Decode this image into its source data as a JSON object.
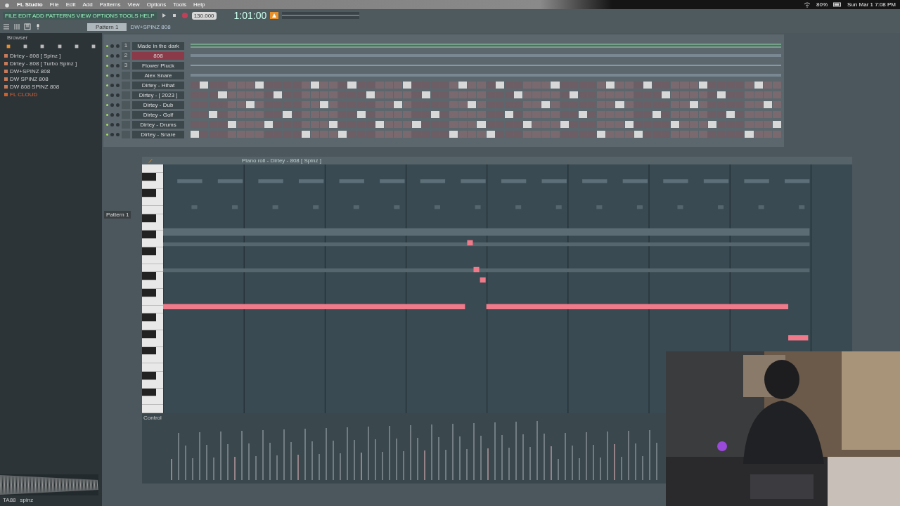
{
  "menu_bar": {
    "app": "FL Studio",
    "items": [
      "File",
      "Edit",
      "Add",
      "Patterns",
      "View",
      "Options",
      "Tools",
      "Help"
    ],
    "battery": "80%",
    "datetime": "Sun Mar 1  7:08 PM"
  },
  "toolbar": {
    "hint": "FILE EDIT ADD PATTERNS VIEW OPTIONS TOOLS HELP",
    "tempo": "130.000",
    "time": "1:01:00",
    "pattern": "Pattern 1",
    "plugin": "DW+SPINZ 808"
  },
  "browser": {
    "title": "Browser",
    "items": [
      {
        "label": "Dirtey - 808 [ Spinz ]",
        "kind": "file"
      },
      {
        "label": "Dirtey - 808 [ Turbo Spinz ]",
        "kind": "file"
      },
      {
        "label": "DW+SPINZ 808",
        "kind": "file"
      },
      {
        "label": "DW SPINZ 808",
        "kind": "file"
      },
      {
        "label": "DW 808 SPINZ 808",
        "kind": "file"
      },
      {
        "label": "FL CLOUD",
        "kind": "cloud"
      }
    ],
    "sample_tag": "TA88",
    "sample_name": "spinz"
  },
  "channel_rack": {
    "channels": [
      {
        "number": "1",
        "name": "Made in the dark",
        "selected": false
      },
      {
        "number": "2",
        "name": "808",
        "selected": true
      },
      {
        "number": "3",
        "name": "Flower Pluck",
        "selected": false
      },
      {
        "name": "Alex Snare",
        "selected": false
      },
      {
        "name": "Dirtey - Hihat",
        "selected": false
      },
      {
        "name": "Dirtey - [ 2023 ]",
        "selected": false
      },
      {
        "name": "Dirtey - Dub",
        "selected": false
      },
      {
        "name": "Dirtey - Golf",
        "selected": false
      },
      {
        "name": "Dirtey - Drums",
        "selected": false
      },
      {
        "name": "Dirtey - Snare",
        "selected": false
      }
    ]
  },
  "piano_roll": {
    "title": "Piano roll - Dirtey - 808 [ Spinz ]",
    "pattern": "Pattern 1",
    "control": "Control"
  }
}
